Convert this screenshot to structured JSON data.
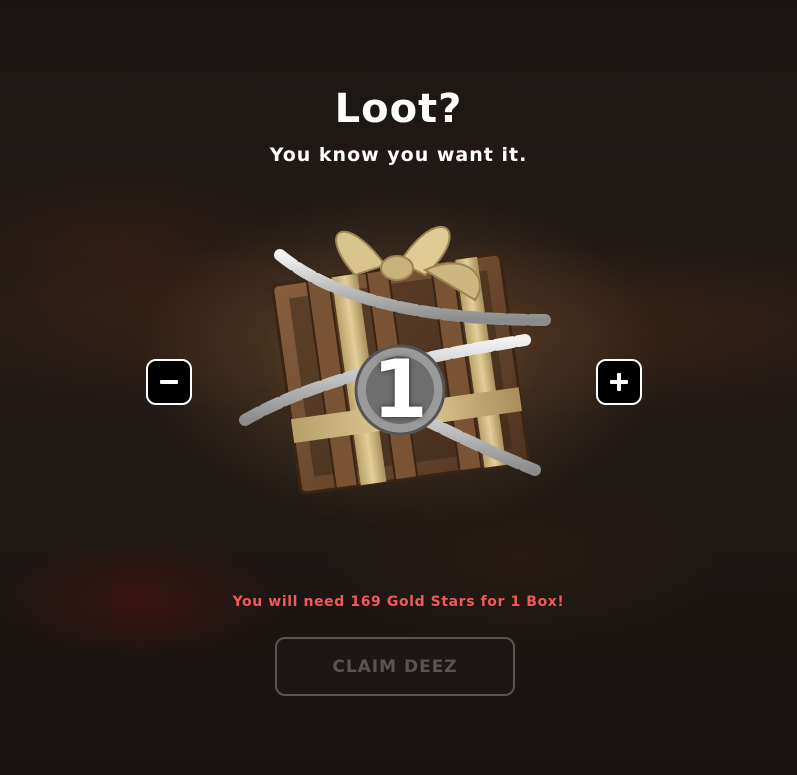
{
  "header": {
    "title": "Loot?",
    "subtitle": "You know you want it."
  },
  "selector": {
    "count": "1",
    "decrement_icon": "minus-icon",
    "increment_icon": "plus-icon",
    "item_icon": "chained-loot-box-icon"
  },
  "notice": {
    "text": "You will need 169 Gold Stars for 1 Box!"
  },
  "actions": {
    "claim_label": "CLAIM DEEZ"
  },
  "colors": {
    "notice": "#f05a5a",
    "claim_disabled": "#5a5350",
    "background": "#1a1412"
  }
}
